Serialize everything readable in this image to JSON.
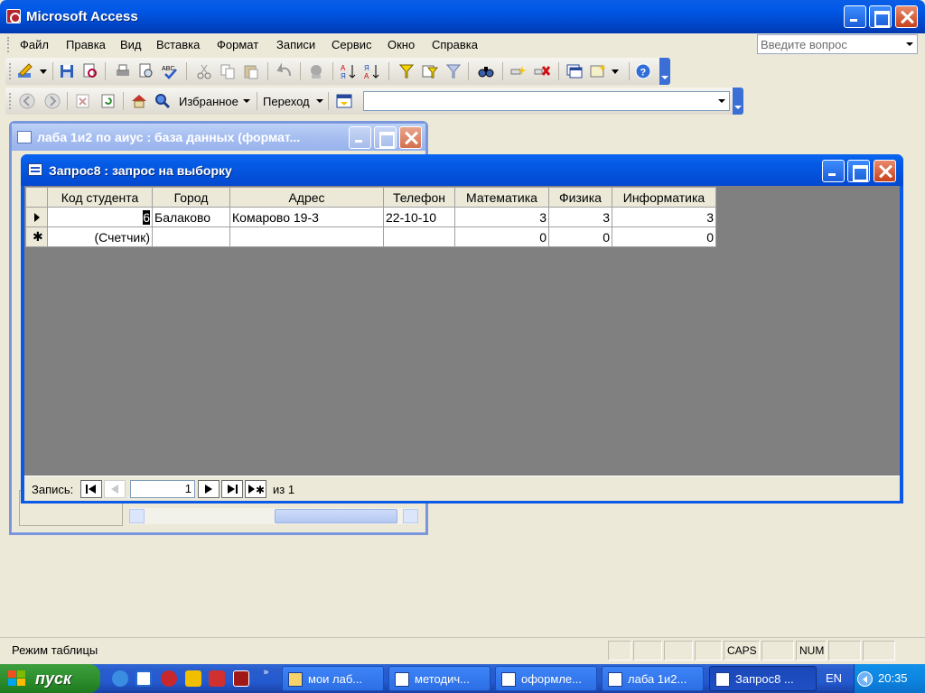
{
  "app": {
    "title": "Microsoft Access",
    "menu": [
      "Файл",
      "Правка",
      "Вид",
      "Вставка",
      "Формат",
      "Записи",
      "Сервис",
      "Окно",
      "Справка"
    ],
    "question_placeholder": "Введите вопрос"
  },
  "toolbar2": {
    "favorites": "Избранное",
    "goto": "Переход"
  },
  "db_window": {
    "title": "лаба 1и2 по аиус : база данных (формат..."
  },
  "query_window": {
    "title": "Запрос8 : запрос на выборку",
    "columns": [
      "Код студента",
      "Город",
      "Адрес",
      "Телефон",
      "Математика",
      "Физика",
      "Информатика"
    ],
    "rows": [
      {
        "id": "6",
        "city": "Балаково",
        "address": "Комарово 19-3",
        "phone": "22-10-10",
        "math": "3",
        "physics": "3",
        "informatics": "3"
      }
    ],
    "new_row": {
      "id": "(Счетчик)",
      "math": "0",
      "physics": "0",
      "informatics": "0"
    },
    "record_label": "Запись:",
    "record_current": "1",
    "record_total": "из 1"
  },
  "statusbar": {
    "text": "Режим таблицы",
    "caps": "CAPS",
    "num": "NUM"
  },
  "taskbar": {
    "start": "пуск",
    "tasks": [
      "мои лаб...",
      "методич...",
      "оформле...",
      "лаба 1и2...",
      "Запрос8 ..."
    ],
    "lang": "EN",
    "clock": "20:35"
  },
  "colors": {
    "title_blue": "#0058e6",
    "start_green": "#2f8f2f",
    "workspace": "#8d94a6",
    "datasheet_bg": "#808080"
  }
}
